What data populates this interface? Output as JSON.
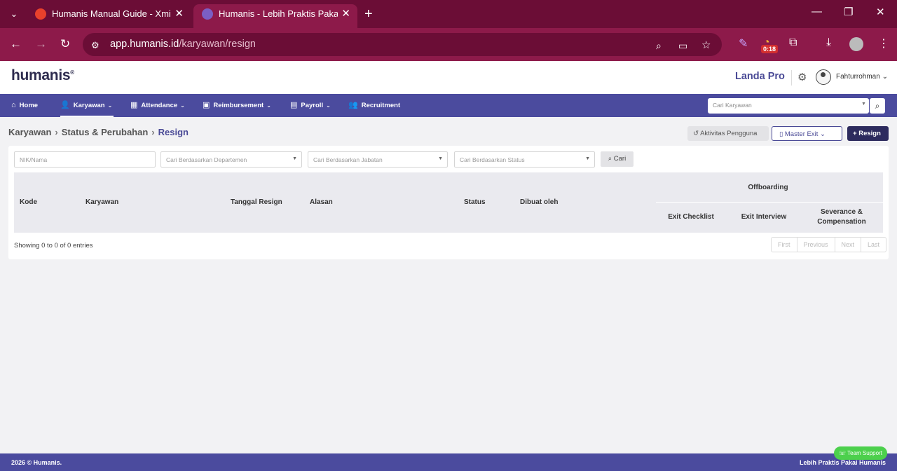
{
  "browser": {
    "tabs": [
      {
        "title": "Humanis Manual Guide - Xmind",
        "active": false
      },
      {
        "title": "Humanis - Lebih Praktis Pakai Humanis",
        "active": true
      }
    ],
    "url_host": "app.humanis.id",
    "url_path": "/karyawan/resign",
    "timer_badge": "0:18"
  },
  "app": {
    "logo": "humanis",
    "plan": "Landa Pro",
    "username": "Fahturrohman"
  },
  "menu": {
    "items": [
      {
        "label": "Home",
        "icon": "home-icon"
      },
      {
        "label": "Karyawan",
        "icon": "user-check-icon"
      },
      {
        "label": "Attendance",
        "icon": "calendar-icon"
      },
      {
        "label": "Reimbursement",
        "icon": "money-icon"
      },
      {
        "label": "Payroll",
        "icon": "wallet-icon"
      },
      {
        "label": "Recruitment",
        "icon": "users-icon"
      }
    ],
    "search_placeholder": "Cari Karyawan"
  },
  "breadcrumb": {
    "items": [
      "Karyawan",
      "Status & Perubahan",
      "Resign"
    ]
  },
  "actions": {
    "activity": "Aktivitas Pengguna",
    "master_exit": "Master Exit",
    "resign": "Resign"
  },
  "filters": {
    "nik_placeholder": "NIK/Nama",
    "department": "Cari Berdasarkan Departemen",
    "position": "Cari Berdasarkan Jabatan",
    "status": "Cari Berdasarkan Status",
    "search_button": "Cari"
  },
  "table": {
    "columns": {
      "kode": "Kode",
      "karyawan": "Karyawan",
      "tanggal": "Tanggal Resign",
      "alasan": "Alasan",
      "status": "Status",
      "dibuat": "Dibuat oleh",
      "offboarding": "Offboarding",
      "exit_checklist": "Exit Checklist",
      "exit_interview": "Exit Interview",
      "severance_1": "Severance &",
      "severance_2": "Compensation"
    },
    "showing": "Showing 0 to 0 of 0 entries",
    "pager": [
      "First",
      "Previous",
      "Next",
      "Last"
    ]
  },
  "footer": {
    "copyright": "2026 © Humanis.",
    "tagline": "Lebih Praktis Pakai Humanis",
    "support": "Team Support"
  },
  "colors": {
    "browser_dark": "#6b0d36",
    "browser_light": "#8d1a4a",
    "menu": "#4b4b9e",
    "accent": "#4a4a96",
    "resign_button": "#2d2b5e",
    "support": "#4cd04c"
  }
}
